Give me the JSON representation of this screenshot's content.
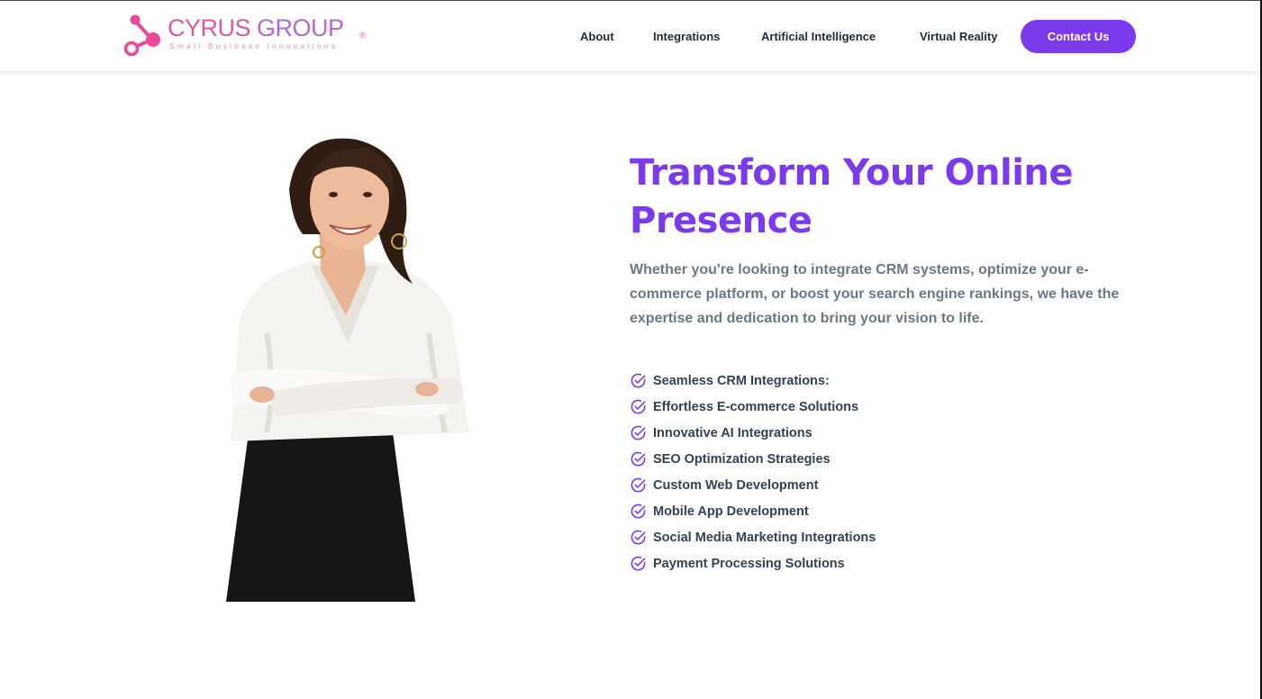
{
  "brand": {
    "name_part1": "CYRUS",
    "name_part2": " GROUP",
    "registered": "®",
    "tagline": "Small Business Innovations",
    "colors": {
      "pink": "#e0589c",
      "purple": "#b369d6"
    }
  },
  "nav": {
    "items": [
      {
        "label": "About"
      },
      {
        "label": "Integrations"
      },
      {
        "label": "Artificial Intelligence"
      },
      {
        "label": "Virtual Reality"
      }
    ],
    "cta_label": "Contact Us"
  },
  "hero": {
    "title": "Transform Your Online Presence",
    "description": "Whether you're looking to integrate CRM systems, optimize your e-commerce platform, or boost your search engine rankings, we have the expertise and dedication to bring your vision to life.",
    "features": [
      "Seamless CRM Integrations:",
      "Effortless E-commerce Solutions",
      "Innovative AI Integrations",
      "SEO Optimization Strategies",
      "Custom Web Development",
      "Mobile App Development",
      "Social Media Marketing Integrations",
      "Payment Processing Solutions"
    ],
    "feature_icon": "check-circle-icon",
    "accent_color": "#7c3aed"
  }
}
